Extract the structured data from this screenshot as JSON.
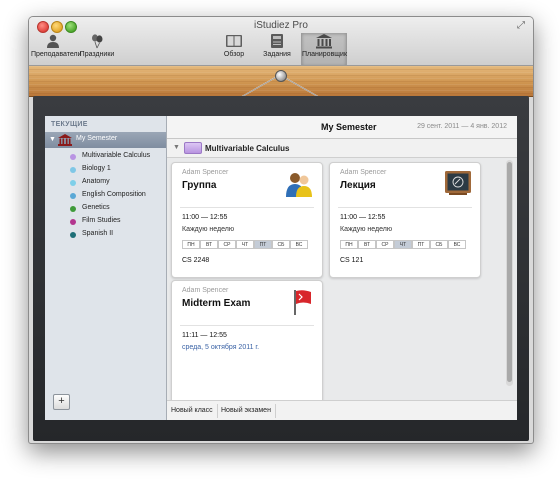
{
  "window": {
    "title": "iStudiez Pro"
  },
  "toolbar": {
    "left": [
      {
        "label": "Преподаватели",
        "icon": "person-icon"
      },
      {
        "label": "Праздники",
        "icon": "balloons-icon"
      }
    ],
    "center": [
      {
        "label": "Обзор",
        "icon": "book-icon"
      },
      {
        "label": "Задания",
        "icon": "notebook-icon"
      },
      {
        "label": "Планировщик",
        "icon": "building-icon",
        "active": true
      }
    ]
  },
  "sidebar": {
    "header": "ТЕКУЩИЕ",
    "semester": "My Semester",
    "courses": [
      {
        "name": "Multivariable Calculus",
        "color": "#b994e3"
      },
      {
        "name": "Biology 1",
        "color": "#7fc7e6"
      },
      {
        "name": "Anatomy",
        "color": "#7ecfe9"
      },
      {
        "name": "English Composition",
        "color": "#5aa8d6"
      },
      {
        "name": "Genetics",
        "color": "#3f9a3a"
      },
      {
        "name": "Film Studies",
        "color": "#b3368f"
      },
      {
        "name": "Spanish II",
        "color": "#1e6f78"
      }
    ],
    "add_label": "+"
  },
  "main": {
    "semester_title": "My Semester",
    "date_range": "29 сент. 2011 — 4 янв. 2012",
    "course_name": "Multivariable Calculus",
    "cards": [
      {
        "teacher": "Adam Spencer",
        "title": "Группа",
        "icon": "group-people-icon",
        "time": "11:00 — 12:55",
        "frequency": "Каждую неделю",
        "days": [
          "ПН",
          "ВТ",
          "СР",
          "ЧТ",
          "ПТ",
          "СБ",
          "ВС"
        ],
        "active_days": [
          "ПТ"
        ],
        "room": "CS 2248"
      },
      {
        "teacher": "Adam Spencer",
        "title": "Лекция",
        "icon": "chalkboard-icon",
        "time": "11:00 — 12:55",
        "frequency": "Каждую неделю",
        "days": [
          "ПН",
          "ВТ",
          "СР",
          "ЧТ",
          "ПТ",
          "СБ",
          "ВС"
        ],
        "active_days": [
          "ЧТ"
        ],
        "room": "CS 121"
      },
      {
        "teacher": "Adam Spencer",
        "title": "Midterm Exam",
        "icon": "red-flag-icon",
        "time": "11:11 — 12:55",
        "date": "среда, 5 октября 2011 г."
      }
    ],
    "bottom_tabs": [
      "Новый класс",
      "Новый экзамен"
    ]
  },
  "colors": {
    "wood": "#cf9550",
    "frame": "#2e3033",
    "sidebar_selected": "#8a97a9",
    "date_link": "#3b63a6",
    "course_swatch": "#c9acec"
  }
}
